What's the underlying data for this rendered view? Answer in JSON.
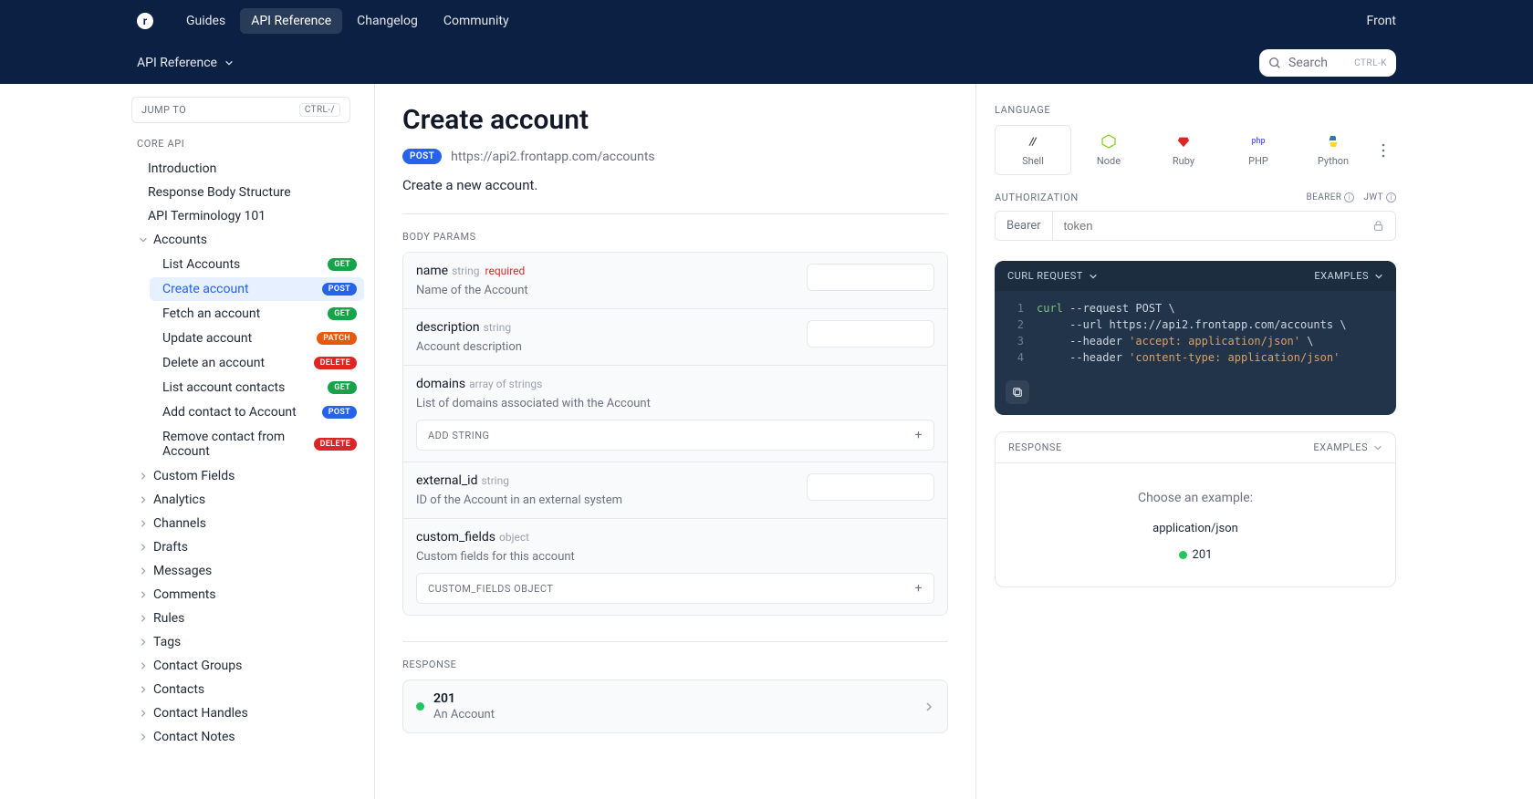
{
  "topnav": {
    "logo_letter": "r",
    "links": [
      "Guides",
      "API Reference",
      "Changelog",
      "Community"
    ],
    "active_index": 1,
    "right_link": "Front"
  },
  "subnav": {
    "label": "API Reference"
  },
  "search": {
    "placeholder": "Search",
    "shortcut": "CTRL-K"
  },
  "sidebar": {
    "jump_to": "JUMP TO",
    "jump_shortcut": "CTRL-/",
    "section_title": "CORE API",
    "top_items": [
      "Introduction",
      "Response Body Structure",
      "API Terminology 101"
    ],
    "accounts_label": "Accounts",
    "accounts_children": [
      {
        "label": "List Accounts",
        "method": "GET"
      },
      {
        "label": "Create account",
        "method": "POST",
        "active": true
      },
      {
        "label": "Fetch an account",
        "method": "GET"
      },
      {
        "label": "Update account",
        "method": "PATCH"
      },
      {
        "label": "Delete an account",
        "method": "DELETE"
      },
      {
        "label": "List account contacts",
        "method": "GET"
      },
      {
        "label": "Add contact to Account",
        "method": "POST"
      },
      {
        "label": "Remove contact from Account",
        "method": "DELETE"
      }
    ],
    "collapsed_groups": [
      "Custom Fields",
      "Analytics",
      "Channels",
      "Drafts",
      "Messages",
      "Comments",
      "Rules",
      "Tags",
      "Contact Groups",
      "Contacts",
      "Contact Handles",
      "Contact Notes"
    ]
  },
  "main": {
    "title": "Create account",
    "method": "POST",
    "url": "https://api2.frontapp.com/accounts",
    "description": "Create a new account.",
    "body_params_label": "BODY PARAMS",
    "params": [
      {
        "name": "name",
        "type": "string",
        "required": true,
        "desc": "Name of the Account",
        "input": true
      },
      {
        "name": "description",
        "type": "string",
        "required": false,
        "desc": "Account description",
        "input": true
      },
      {
        "name": "domains",
        "type": "array of strings",
        "required": false,
        "desc": "List of domains associated with the Account",
        "expand": "ADD STRING"
      },
      {
        "name": "external_id",
        "type": "string",
        "required": false,
        "desc": "ID of the Account in an external system",
        "input": true
      },
      {
        "name": "custom_fields",
        "type": "object",
        "required": false,
        "desc": "Custom fields for this account",
        "expand": "CUSTOM_FIELDS OBJECT"
      }
    ],
    "response_label": "RESPONSE",
    "response_status": "201",
    "response_desc": "An Account"
  },
  "right": {
    "language_label": "LANGUAGE",
    "languages": [
      "Shell",
      "Node",
      "Ruby",
      "PHP",
      "Python"
    ],
    "language_active": 0,
    "authorization_label": "AUTHORIZATION",
    "auth_badges": [
      "BEARER",
      "JWT"
    ],
    "bearer_label": "Bearer",
    "token_placeholder": "token",
    "curl_title": "CURL REQUEST",
    "examples_label": "EXAMPLES",
    "code_lines": [
      {
        "n": "1",
        "indent": "",
        "cmd": "curl",
        "plain": " --request POST \\"
      },
      {
        "n": "2",
        "indent": "     ",
        "plain": "--url https://api2.frontapp.com/accounts \\"
      },
      {
        "n": "3",
        "indent": "     ",
        "plain": "--header ",
        "str": "'accept: application/json'",
        "tail": " \\"
      },
      {
        "n": "4",
        "indent": "     ",
        "plain": "--header ",
        "str": "'content-type: application/json'"
      }
    ],
    "response_panel": {
      "title": "RESPONSE",
      "choose": "Choose an example:",
      "content_type": "application/json",
      "status": "201"
    }
  }
}
